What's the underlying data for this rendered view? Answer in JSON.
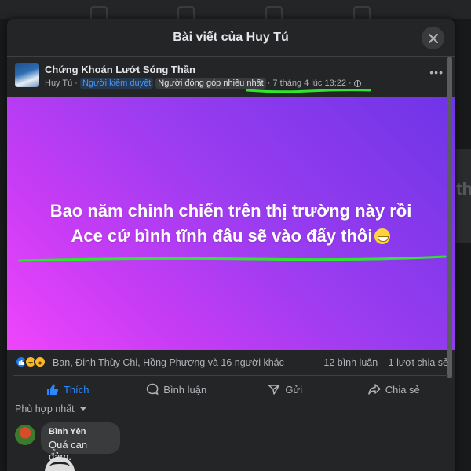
{
  "modal": {
    "title": "Bài viết của Huy Tú",
    "close_icon": "close-icon"
  },
  "post": {
    "group_name": "Chứng Khoán Lướt Sóng Thần",
    "author": "Huy Tú",
    "separator": "·",
    "badge_moderator": "Người kiểm duyệt",
    "badge_top_contributor": "Người đóng góp nhiều nhất",
    "time": "7 tháng 4 lúc 13:22",
    "privacy_icon": "globe-icon",
    "more_icon": "more-icon",
    "text_line1": "Bao năm chinh chiến trên thị trường này rồi",
    "text_line2": "Ace cứ bình tĩnh đâu sẽ vào đấy thôi",
    "emoji_icon": "grinning-emoji-icon",
    "banner_colors": [
      "#6f34e7",
      "#ef45fb"
    ],
    "annotation_color": "#2ee62e"
  },
  "reactions": {
    "icons": [
      "like-icon",
      "haha-icon",
      "wow-icon"
    ],
    "names": "Bạn, Đinh Thùy Chi, Hồng Phượng và 16 người khác",
    "comments_count": "12 bình luận",
    "shares_count": "1 lượt chia sẻ"
  },
  "actions": {
    "like": "Thích",
    "comment": "Bình luận",
    "send": "Gửi",
    "share": "Chia sẻ"
  },
  "comments": {
    "sort_label": "Phù hợp nhất",
    "items": [
      {
        "name": "Bình Yên",
        "text": "Quá can đảm."
      }
    ]
  },
  "colors": {
    "background": "#18191a",
    "surface": "#242526",
    "accent": "#2d88ff"
  }
}
